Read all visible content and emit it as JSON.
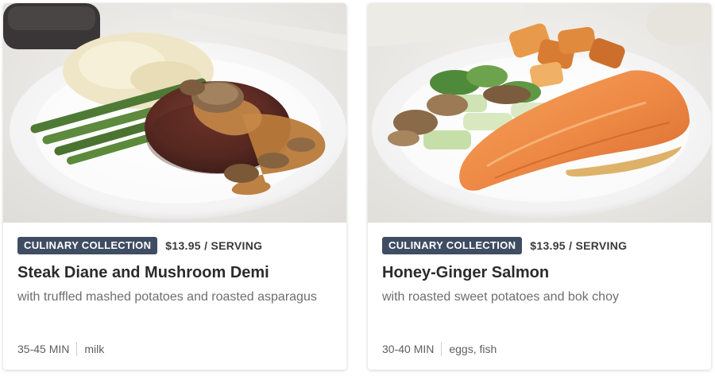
{
  "cards": [
    {
      "badge": "CULINARY COLLECTION",
      "price": "$13.95 / SERVING",
      "title": "Steak Diane and Mushroom Demi",
      "subtitle": "with truffled mashed potatoes and roasted asparagus",
      "time": "35-45 MIN",
      "allergens": "milk"
    },
    {
      "badge": "CULINARY COLLECTION",
      "price": "$13.95 / SERVING",
      "title": "Honey-Ginger Salmon",
      "subtitle": "with roasted sweet potatoes and bok choy",
      "time": "30-40 MIN",
      "allergens": "eggs, fish"
    }
  ],
  "colors": {
    "badge_bg": "#3f4d63",
    "badge_text": "#ffffff",
    "title": "#2b2b2b",
    "subtitle": "#6e6e6e"
  }
}
